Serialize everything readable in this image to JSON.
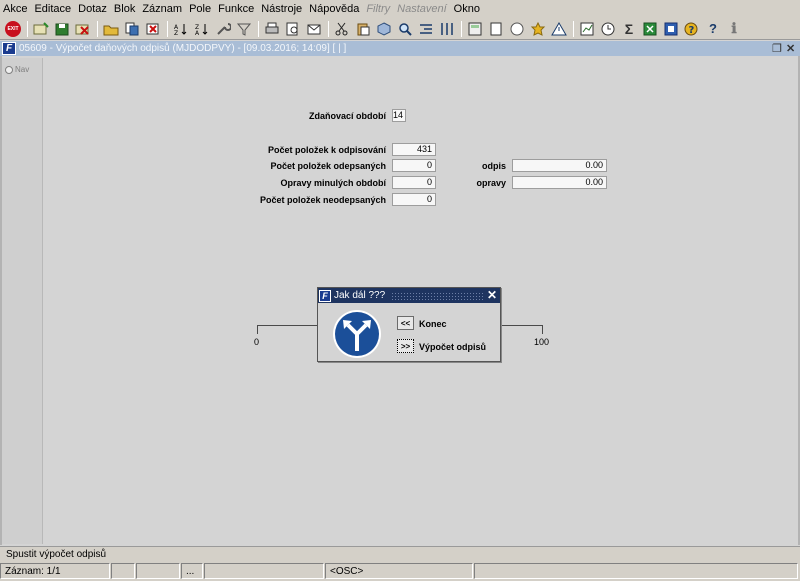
{
  "menu": [
    {
      "label": "Akce",
      "enabled": true
    },
    {
      "label": "Editace",
      "enabled": true
    },
    {
      "label": "Dotaz",
      "enabled": true
    },
    {
      "label": "Blok",
      "enabled": true
    },
    {
      "label": "Záznam",
      "enabled": true
    },
    {
      "label": "Pole",
      "enabled": true
    },
    {
      "label": "Funkce",
      "enabled": true
    },
    {
      "label": "Nástroje",
      "enabled": true
    },
    {
      "label": "Nápověda",
      "enabled": true
    },
    {
      "label": "Filtry",
      "enabled": false
    },
    {
      "label": "Nastavení",
      "enabled": false
    },
    {
      "label": "Okno",
      "enabled": true
    }
  ],
  "toolbar": {
    "exit_label": "EXIT",
    "icons": [
      "insert-record-icon",
      "save-icon",
      "delete-record-icon",
      "folder-open-icon",
      "copy-icon",
      "clear-icon",
      "sort-asc-icon",
      "sort-desc-icon",
      "wrench-icon",
      "filter-icon",
      "print-icon",
      "print-preview-icon",
      "mail-icon",
      "scissors-icon",
      "paste-icon",
      "cube-icon",
      "find-icon",
      "list-indent-icon",
      "columns-icon",
      "calculator-icon",
      "document-icon",
      "globe-icon",
      "star-icon",
      "warning-icon",
      "report-icon",
      "clock-icon",
      "sigma-icon",
      "excel-icon",
      "word-icon",
      "help-icon",
      "about-icon",
      "info-icon"
    ],
    "sigma_glyph": "Σ",
    "info_glyph": "ℹ",
    "help_glyph": "?"
  },
  "window": {
    "logo": "F",
    "title": "05609 - Výpočet daňových odpisů (MJDODPVY) - [09.03.2016; 14:09] [ | ]"
  },
  "nav": {
    "label": "Nav"
  },
  "form": {
    "period": {
      "label": "Zdaňovací období",
      "value": "14"
    },
    "count_to_depreciate": {
      "label": "Počet položek k odpisování",
      "value": "431"
    },
    "count_depreciated": {
      "label": "Počet položek odepsaných",
      "value": "0"
    },
    "past_corrections": {
      "label": "Opravy minulých období",
      "value": "0"
    },
    "count_not_depreciated": {
      "label": "Počet položek neodepsaných",
      "value": "0"
    },
    "odpis": {
      "label": "odpis",
      "value": "0.00"
    },
    "opravy": {
      "label": "opravy",
      "value": "0.00"
    }
  },
  "progress": {
    "min_label": "0",
    "max_label": "100",
    "value": 0
  },
  "dialog": {
    "logo": "F",
    "title": "Jak dál ???",
    "close_glyph": "✕",
    "buttons": [
      {
        "glyph": "<<",
        "label": "Konec"
      },
      {
        "glyph": ">>",
        "label": "Výpočet odpisů"
      }
    ]
  },
  "status": {
    "hint": "Spustit výpočet odpisů",
    "record": "Záznam: 1/1",
    "ellipsis": "...",
    "mode": "<OSC>"
  }
}
